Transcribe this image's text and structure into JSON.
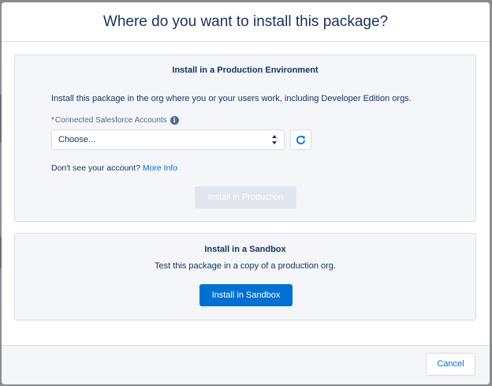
{
  "modal": {
    "title": "Where do you want to install this package?"
  },
  "production": {
    "title": "Install in a Production Environment",
    "description": "Install this package in the org where you or your users work, including Developer Edition orgs.",
    "field_required_mark": "*",
    "field_label": "Connected Salesforce Accounts",
    "info_icon_glyph": "i",
    "select_value": "Choose...",
    "no_account_text": "Don't see your account?",
    "more_info_link": "More Info",
    "install_button": "Install in Production"
  },
  "sandbox": {
    "title": "Install in a Sandbox",
    "description": "Test this package in a copy of a production org.",
    "install_button": "Install in Sandbox"
  },
  "footer": {
    "cancel_button": "Cancel"
  },
  "icons": {
    "info": "info-icon",
    "select_arrows": "chevron-updown-icon",
    "refresh": "refresh-icon"
  },
  "colors": {
    "brand": "#0070d2",
    "text": "#16325c",
    "required": "#c23934",
    "disabled_button": "#e0e5ee",
    "card_background": "#f4f6f9",
    "border": "#d8dde6"
  }
}
